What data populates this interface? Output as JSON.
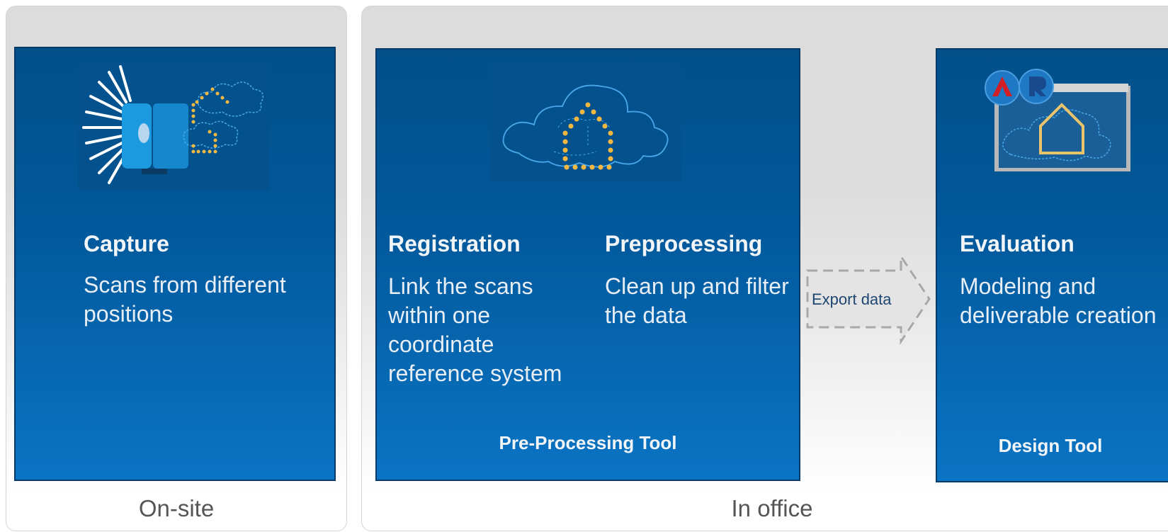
{
  "groups": {
    "onsite_label": "On-site",
    "office_label": "In office"
  },
  "capture": {
    "title": "Capture",
    "description": "Scans from different positions"
  },
  "preprocessing_tool": {
    "registration_title": "Registration",
    "registration_description": "Link the scans within one coordinate reference system",
    "preprocessing_title": "Preprocessing",
    "preprocessing_description": "Clean up and filter the data",
    "tool_label": "Pre-Processing Tool"
  },
  "export": {
    "label": "Export data"
  },
  "evaluation": {
    "title": "Evaluation",
    "description": "Modeling and deliverable creation",
    "tool_label": "Design Tool",
    "app_icons": [
      "autocad-icon",
      "revit-icon"
    ]
  },
  "colors": {
    "card_top": "#01508a",
    "card_bottom": "#0a74c4",
    "dot_accent": "#f5b942",
    "cloud_stroke": "#4aa8e8"
  }
}
